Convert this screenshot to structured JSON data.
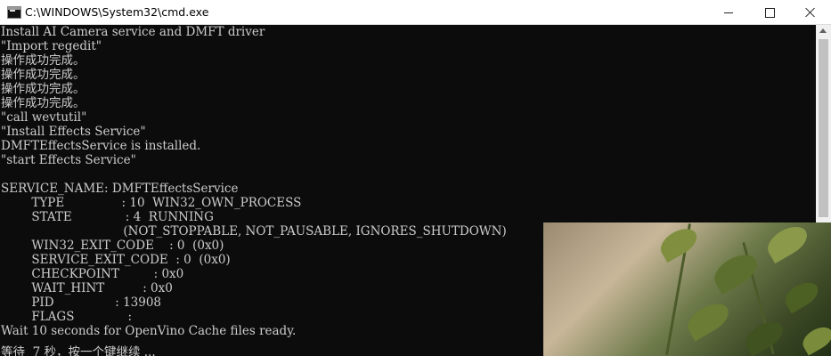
{
  "window": {
    "title": "C:\\WINDOWS\\System32\\cmd.exe"
  },
  "console": {
    "lines": [
      "Install AI Camera service and DMFT driver",
      "\"Import regedit\"",
      "操作成功完成。",
      "操作成功完成。",
      "操作成功完成。",
      "操作成功完成。",
      "\"call wevtutil\"",
      "\"Install Effects Service\"",
      "DMFTEffectsService is installed.",
      "\"start Effects Service\"",
      "",
      "SERVICE_NAME: DMFTEffectsService",
      "        TYPE               : 10  WIN32_OWN_PROCESS",
      "        STATE              : 4  RUNNING",
      "                                (NOT_STOPPABLE, NOT_PAUSABLE, IGNORES_SHUTDOWN)",
      "        WIN32_EXIT_CODE    : 0  (0x0)",
      "        SERVICE_EXIT_CODE  : 0  (0x0)",
      "        CHECKPOINT         : 0x0",
      "        WAIT_HINT          : 0x0",
      "        PID                : 13908",
      "        FLAGS              :",
      "Wait 10 seconds for OpenVino Cache files ready.",
      "",
      "等待  7 秒，按一个键继续 ..."
    ]
  },
  "icons": {
    "app": "console-icon",
    "minimize": "minimize-icon",
    "maximize": "maximize-icon",
    "close": "close-icon",
    "scroll_up": "arrow-up-icon"
  },
  "colors": {
    "console_bg": "#0c0c0c",
    "console_text": "#cccccc",
    "titlebar_bg": "#ffffff"
  }
}
